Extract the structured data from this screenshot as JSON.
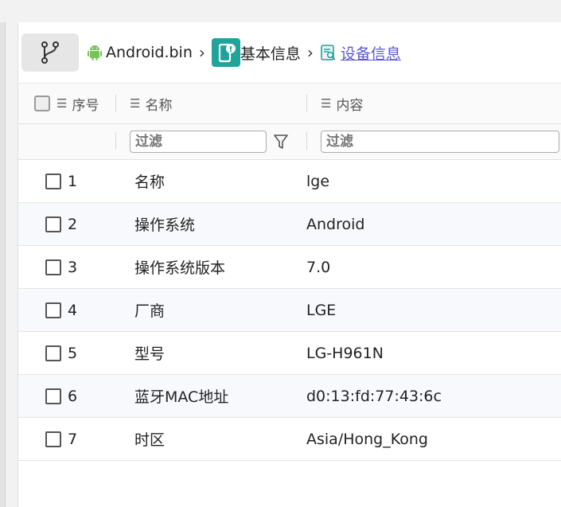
{
  "breadcrumb": {
    "file": "Android.bin",
    "section": "基本信息",
    "current": "设备信息",
    "separator": "›"
  },
  "icons": {
    "tree": "branch-icon",
    "file": "android-icon",
    "section": "phone-info-icon",
    "current": "document-search-icon"
  },
  "colors": {
    "android_green": "#78c257",
    "section_teal": "#1fa39a",
    "link": "#5b57d1"
  },
  "table": {
    "columns": [
      "序号",
      "名称",
      "内容"
    ],
    "filter_placeholder": "过滤",
    "rows": [
      {
        "index": "1",
        "name": "名称",
        "value": "lge"
      },
      {
        "index": "2",
        "name": "操作系统",
        "value": "Android"
      },
      {
        "index": "3",
        "name": "操作系统版本",
        "value": "7.0"
      },
      {
        "index": "4",
        "name": "厂商",
        "value": "LGE"
      },
      {
        "index": "5",
        "name": "型号",
        "value": "LG-H961N"
      },
      {
        "index": "6",
        "name": "蓝牙MAC地址",
        "value": "d0:13:fd:77:43:6c"
      },
      {
        "index": "7",
        "name": "时区",
        "value": "Asia/Hong_Kong"
      }
    ]
  }
}
